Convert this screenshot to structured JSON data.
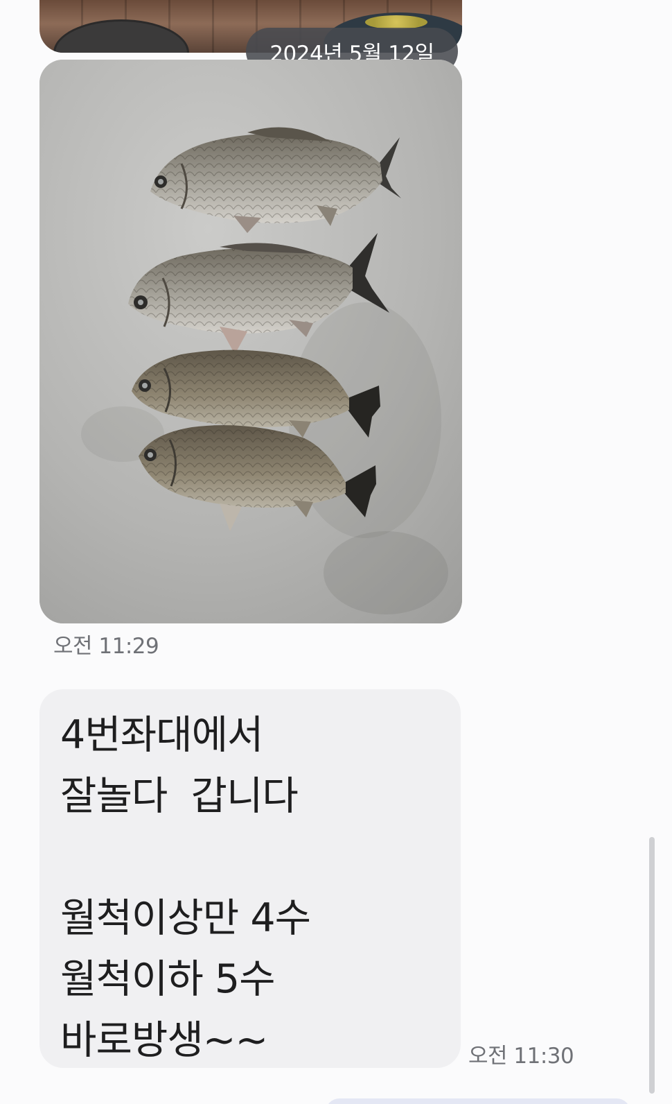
{
  "chat": {
    "date_divider": "2024년 5월 12일",
    "messages": [
      {
        "type": "image",
        "image_desc_icon": "fish-photo",
        "time": "오전 11:29"
      },
      {
        "type": "text",
        "lines": [
          "4번좌대에서",
          "잘놀다  갑니다",
          "",
          "월척이상만 4수",
          "월척이하 5수",
          "바로방생~~"
        ],
        "time": "오전 11:30"
      }
    ]
  },
  "colors": {
    "background": "#fbfbfc",
    "bubble": "#f0f0f2",
    "date_pill": "#484a50",
    "time_text": "#6f7176",
    "message_text": "#1e1e1f"
  }
}
